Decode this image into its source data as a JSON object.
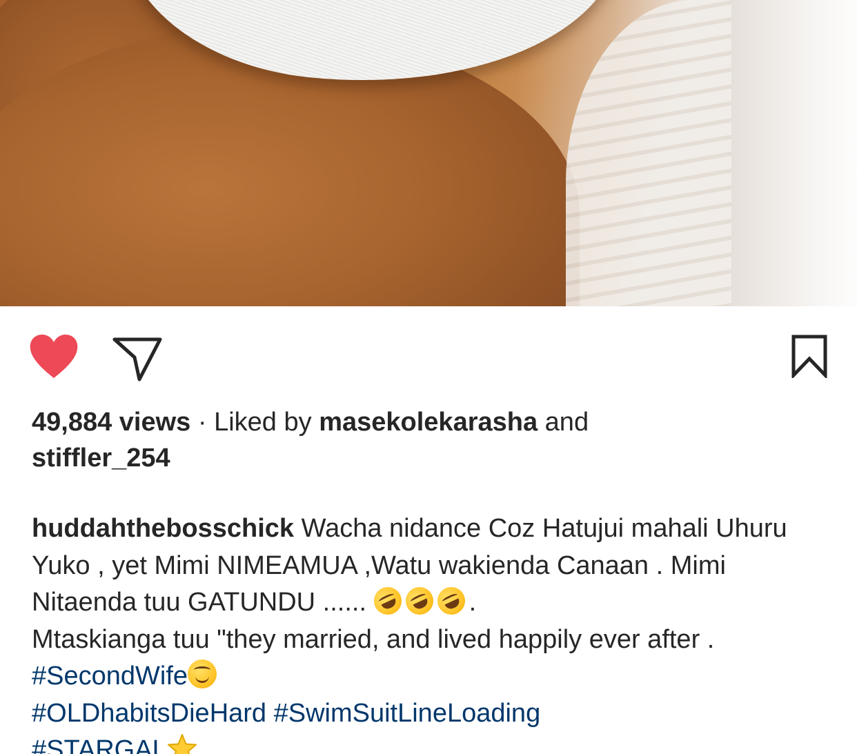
{
  "post": {
    "media": {
      "icon": "photo-content"
    },
    "actions": {
      "like_icon": "heart-filled-icon",
      "like_color": "#ed4956",
      "share_icon": "paper-plane-icon",
      "save_icon": "bookmark-icon"
    },
    "stats": {
      "views": "49,884 views",
      "separator": "·",
      "liked_by_prefix": "Liked by",
      "liked_by_user": "masekolekarasha",
      "and": "and",
      "other_user": "stiffler_254"
    },
    "caption": {
      "username": "huddahthebosschick",
      "text_1": "Wacha nidance Coz Hatujui mahali Uhuru Yuko , yet Mimi NIMEAMUA ,Watu wakienda Canaan . Mimi Nitaenda tuu GATUNDU ......",
      "text_1_end": ".",
      "text_2": "Mtaskianga tuu \"they married, and lived happily ever after .",
      "hashtags": [
        "#SecondWife",
        "#OLDhabitsDieHard #SwimSuitLineLoading",
        "#STARGAL"
      ],
      "emoji_rofl": "rolling-on-floor-laughing-emoji",
      "emoji_smile": "smiling-face-emoji",
      "emoji_star": "star-emoji",
      "hashtag_color": "#00376b"
    }
  }
}
